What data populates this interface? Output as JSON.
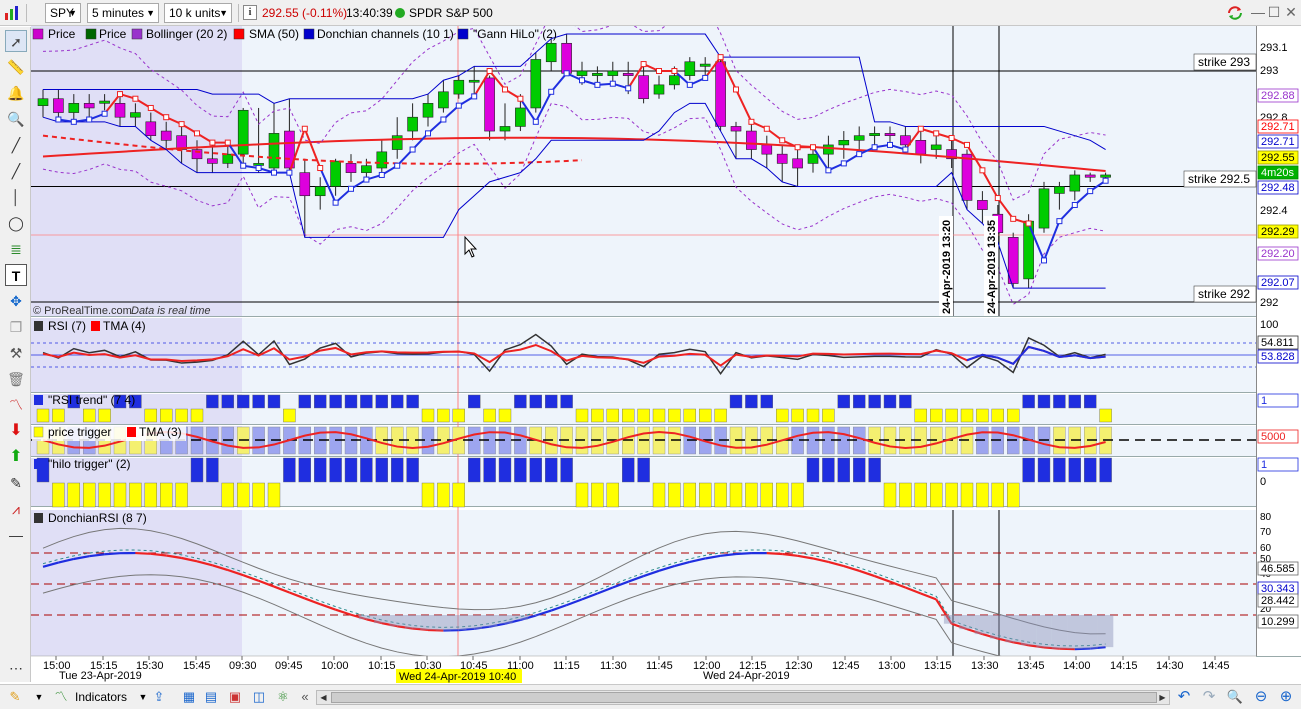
{
  "topbar": {
    "symbol": "SPY",
    "timeframe": "5 minutes",
    "units": "10 k units",
    "info_icon": "i",
    "last_price": "292.55",
    "change": "(-0.11%)",
    "time": "13:40:39",
    "instrument_name": "SPDR S&P 500",
    "status_color": "#22aa22"
  },
  "legend": {
    "items": [
      {
        "label": "Price",
        "swatch": "#cc00cc"
      },
      {
        "label": "Price",
        "swatch": "#00aa00"
      },
      {
        "label": "Bollinger (20 2)",
        "swatch": "#9933cc"
      },
      {
        "label": "SMA (50)",
        "swatch": "#ff0000"
      },
      {
        "label": "Donchian channels (10 1)",
        "swatch": "#0000cc"
      },
      {
        "label": "\"Gann HiLo\" (2)",
        "swatch": "#0000cc"
      }
    ],
    "copyright": "© ProRealTime.com",
    "realtime_note": "Data is real time"
  },
  "price_panel": {
    "axis_ticks": [
      "293.1",
      "293",
      "292.8",
      "292.4",
      "292"
    ],
    "badges": [
      {
        "text": "292.88",
        "bg": "#ffffff",
        "fg": "#9933cc",
        "border": "#9933cc"
      },
      {
        "text": "292.71",
        "bg": "#ffffff",
        "fg": "#ff0000",
        "border": "#ff0000"
      },
      {
        "text": "292.71",
        "bg": "#ffffff",
        "fg": "#0000cc",
        "border": "#0000cc"
      },
      {
        "text": "292.55",
        "bg": "#ffff00",
        "fg": "#000000",
        "border": "#999900"
      },
      {
        "text": "4m20s",
        "bg": "#00b000",
        "fg": "#ffffff",
        "border": "#008800"
      },
      {
        "text": "292.48",
        "bg": "#ffffff",
        "fg": "#0000cc",
        "border": "#0000cc"
      },
      {
        "text": "292.29",
        "bg": "#ffff00",
        "fg": "#000000",
        "border": "#999900"
      },
      {
        "text": "292.20",
        "bg": "#ffffff",
        "fg": "#9933cc",
        "border": "#9933cc"
      },
      {
        "text": "292.07",
        "bg": "#ffffff",
        "fg": "#0000cc",
        "border": "#0000cc"
      }
    ],
    "strikes": [
      {
        "label": "strike 293"
      },
      {
        "label": "strike 292.5"
      },
      {
        "label": "strike 292"
      }
    ],
    "vertical_labels": [
      "24-Apr-2019 13:20",
      "24-Apr-2019 13:35"
    ]
  },
  "rsi_panel": {
    "title_rsi": "RSI (7)",
    "title_tma": "TMA (4)",
    "rsi_color": "#333333",
    "tma_color": "#ff0000",
    "axis_ticks": [
      "100"
    ],
    "badges": [
      {
        "text": "54.811",
        "bg": "#ffffff",
        "fg": "#000000",
        "border": "#333333"
      },
      {
        "text": "53.828",
        "bg": "#ffffff",
        "fg": "#0000cc",
        "border": "#0000cc"
      }
    ]
  },
  "rsi_trend_panel": {
    "title": "\"RSI trend\" (7 4)",
    "badge": "1"
  },
  "price_trigger_panel": {
    "title_a": "price trigger",
    "title_b": "TMA (3)",
    "badge": "5000"
  },
  "hilo_trigger_panel": {
    "title": "\"hilo trigger\" (2)",
    "badge": "1",
    "axis_ticks": [
      "0"
    ]
  },
  "donchian_rsi_panel": {
    "title": "DonchianRSI (8 7)",
    "axis_ticks": [
      "80",
      "70",
      "60",
      "50",
      "40",
      "30",
      "20"
    ],
    "badges": [
      {
        "text": "46.585",
        "bg": "#ffffff",
        "fg": "#000000",
        "border": "#666666"
      },
      {
        "text": "30.343",
        "bg": "#ffffff",
        "fg": "#0000cc",
        "border": "#0000cc"
      },
      {
        "text": "28.442",
        "bg": "#ffffff",
        "fg": "#000000",
        "border": "#666666"
      },
      {
        "text": "10.299",
        "bg": "#ffffff",
        "fg": "#000000",
        "border": "#666666"
      }
    ]
  },
  "time_axis": {
    "ticks": [
      "15:00",
      "15:15",
      "15:30",
      "15:45",
      "09:30",
      "09:45",
      "10:00",
      "10:15",
      "10:30",
      "10:45",
      "11:00",
      "11:15",
      "11:30",
      "11:45",
      "12:00",
      "12:15",
      "12:30",
      "12:45",
      "13:00",
      "13:15",
      "13:30",
      "13:45",
      "14:00",
      "14:15",
      "14:30",
      "14:45"
    ],
    "date_left": "Tue 23-Apr-2019",
    "date_highlight": "Wed 24-Apr-2019 10:40",
    "date_right": "Wed 24-Apr-2019"
  },
  "bottombar": {
    "indicators_label": "Indicators"
  },
  "colors": {
    "bull": "#00cc00",
    "bear": "#dd00dd",
    "panel_bg": "#eef4fb",
    "prev_session_bg": "#dcd9f5",
    "strike_line": "#000000",
    "trend_blue": "#1f2ee0",
    "trend_yellow": "#ffff00"
  }
}
